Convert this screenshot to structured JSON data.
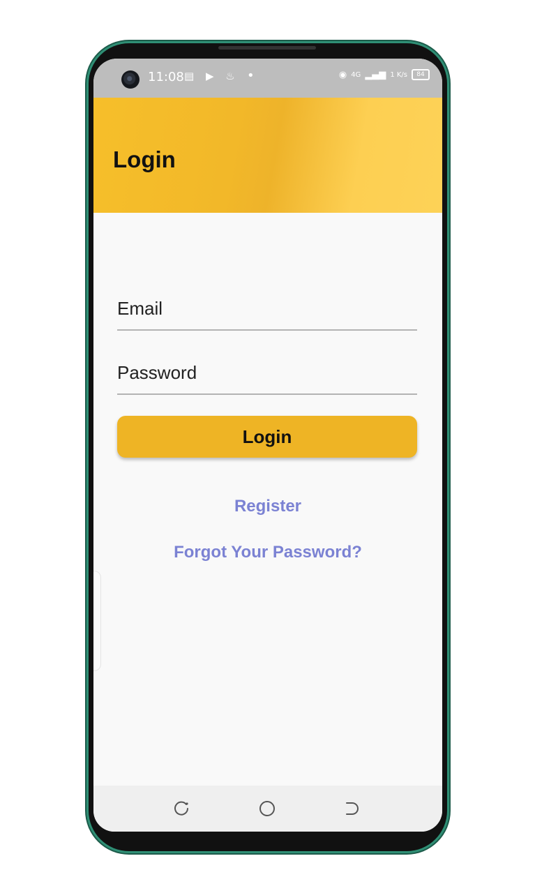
{
  "status_bar": {
    "time": "11:08",
    "left_icons": "▤ ▶ ♨",
    "dot": "•",
    "network": "4G",
    "speed": "1 K/s",
    "battery": "84"
  },
  "app_bar": {
    "title": "Login"
  },
  "form": {
    "email_placeholder": "Email",
    "password_placeholder": "Password",
    "login_label": "Login"
  },
  "links": {
    "register": "Register",
    "forgot_password": "Forgot Your Password?"
  },
  "colors": {
    "accent": "#EEB425",
    "link": "#7B82D3",
    "status_bar": "#BDBDBD"
  },
  "nav_icons": [
    "recent-apps-icon",
    "home-icon",
    "back-icon"
  ]
}
